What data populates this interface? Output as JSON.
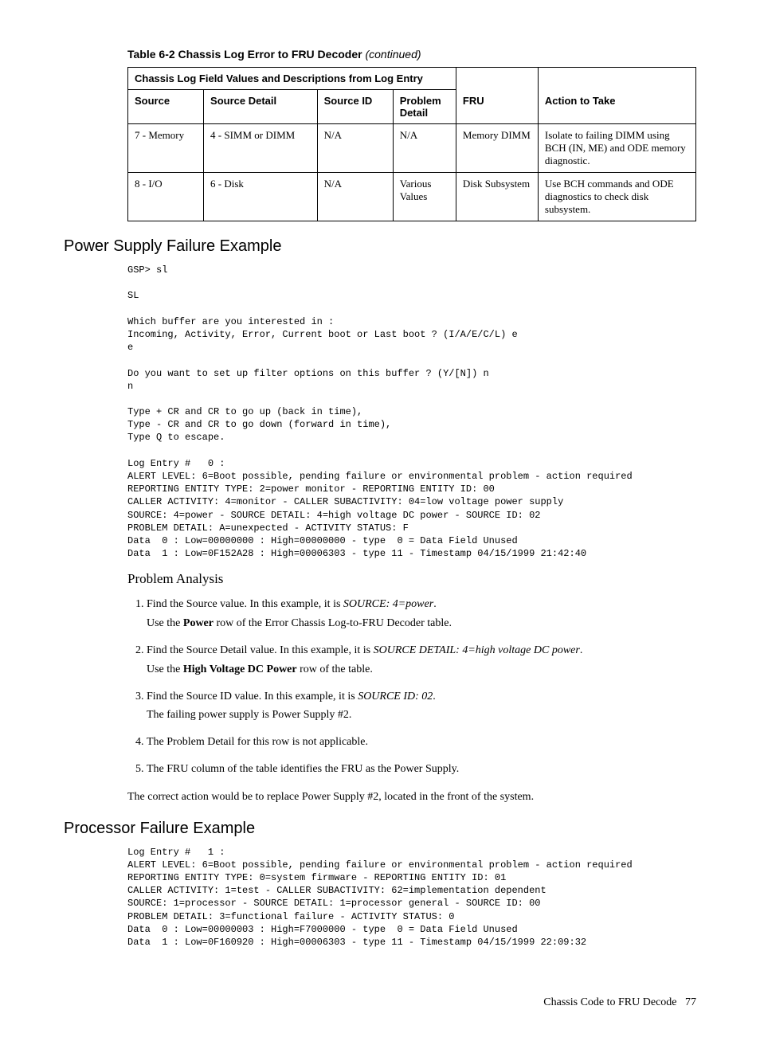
{
  "table": {
    "caption_prefix": "Table 6-2 Chassis Log Error to FRU Decoder",
    "caption_suffix": "(continued)",
    "super_header": "Chassis Log Field Values and Descriptions from Log Entry",
    "headers": {
      "source": "Source",
      "source_detail": "Source Detail",
      "source_id": "Source ID",
      "problem_detail": "Problem Detail",
      "fru": "FRU",
      "action": "Action to Take"
    },
    "rows": [
      {
        "source": "7 - Memory",
        "source_detail": "4 - SIMM or DIMM",
        "source_id": "N/A",
        "problem_detail": "N/A",
        "fru": "Memory DIMM",
        "action": "Isolate to failing DIMM using BCH (IN, ME) and ODE memory diagnostic."
      },
      {
        "source": "8 - I/O",
        "source_detail": "6 - Disk",
        "source_id": "N/A",
        "problem_detail": "Various Values",
        "fru": "Disk Subsystem",
        "action": "Use BCH commands and ODE diagnostics to check disk subsystem."
      }
    ]
  },
  "section1": {
    "heading": "Power Supply Failure Example",
    "code": "GSP> sl\n\nSL\n\nWhich buffer are you interested in :\nIncoming, Activity, Error, Current boot or Last boot ? (I/A/E/C/L) e\ne\n\nDo you want to set up filter options on this buffer ? (Y/[N]) n\nn\n\nType + CR and CR to go up (back in time),\nType - CR and CR to go down (forward in time),\nType Q to escape.\n\nLog Entry #   0 :\nALERT LEVEL: 6=Boot possible, pending failure or environmental problem - action required\nREPORTING ENTITY TYPE: 2=power monitor - REPORTING ENTITY ID: 00\nCALLER ACTIVITY: 4=monitor - CALLER SUBACTIVITY: 04=low voltage power supply\nSOURCE: 4=power - SOURCE DETAIL: 4=high voltage DC power - SOURCE ID: 02\nPROBLEM DETAIL: A=unexpected - ACTIVITY STATUS: F\nData  0 : Low=00000000 : High=00000000 - type  0 = Data Field Unused\nData  1 : Low=0F152A28 : High=00006303 - type 11 - Timestamp 04/15/1999 21:42:40"
  },
  "analysis": {
    "heading": "Problem Analysis",
    "items": {
      "i1a": "Find the Source value. In this example, it is ",
      "i1b": "SOURCE: 4=power",
      "i1c": ".",
      "i1d": "Use the ",
      "i1e": "Power",
      "i1f": " row of the Error Chassis Log-to-FRU Decoder table.",
      "i2a": "Find the Source Detail value. In this example, it is ",
      "i2b": "SOURCE DETAIL: 4=high voltage DC power",
      "i2c": ".",
      "i2d": "Use the ",
      "i2e": "High Voltage DC Power",
      "i2f": " row of the table.",
      "i3a": "Find the Source ID value. In this example, it is ",
      "i3b": "SOURCE ID: 02",
      "i3c": ".",
      "i3d": "The failing power supply is Power Supply #2.",
      "i4": "The Problem Detail for this row is not applicable.",
      "i5": "The FRU column of the table identifies the FRU as the Power Supply."
    },
    "conclusion": "The correct action would be to replace Power Supply #2, located in the front of the system."
  },
  "section2": {
    "heading": "Processor Failure Example",
    "code": "Log Entry #   1 :\nALERT LEVEL: 6=Boot possible, pending failure or environmental problem - action required\nREPORTING ENTITY TYPE: 0=system firmware - REPORTING ENTITY ID: 01\nCALLER ACTIVITY: 1=test - CALLER SUBACTIVITY: 62=implementation dependent\nSOURCE: 1=processor - SOURCE DETAIL: 1=processor general - SOURCE ID: 00\nPROBLEM DETAIL: 3=functional failure - ACTIVITY STATUS: 0\nData  0 : Low=00000003 : High=F7000000 - type  0 = Data Field Unused\nData  1 : Low=0F160920 : High=00006303 - type 11 - Timestamp 04/15/1999 22:09:32"
  },
  "footer": {
    "text": "Chassis Code to FRU Decode",
    "page": "77"
  }
}
